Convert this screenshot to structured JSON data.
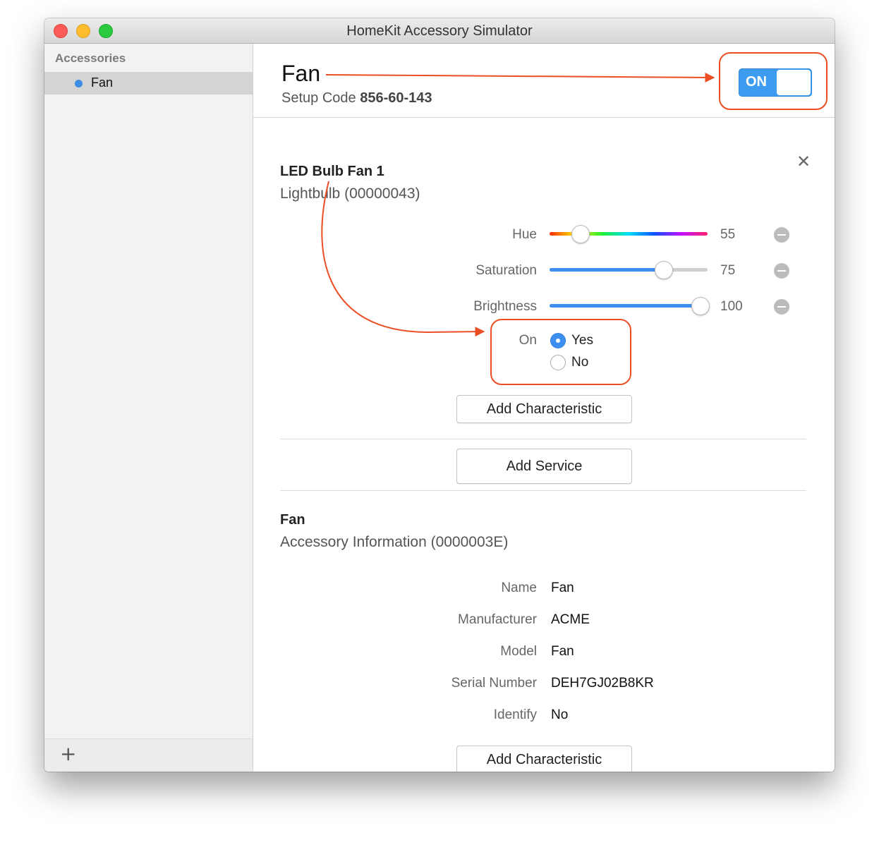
{
  "window": {
    "title": "HomeKit Accessory Simulator"
  },
  "sidebar": {
    "header": "Accessories",
    "items": [
      {
        "label": "Fan",
        "dot_color": "#3b8ce3"
      }
    ],
    "add_icon": "plus-icon",
    "add_glyph": "+"
  },
  "accessory": {
    "name": "Fan",
    "setup_code_label": "Setup Code",
    "setup_code": "856-60-143",
    "power_toggle": {
      "label": "ON",
      "state": "on"
    }
  },
  "services": [
    {
      "name": "LED Bulb Fan 1",
      "type": "Lightbulb (00000043)",
      "close_glyph": "✕",
      "characteristics": {
        "hue": {
          "label": "Hue",
          "value": "55",
          "fraction": 0.19
        },
        "saturation": {
          "label": "Saturation",
          "value": "75",
          "fraction": 0.72
        },
        "brightness": {
          "label": "Brightness",
          "value": "100",
          "fraction": 0.95
        },
        "on": {
          "label": "On",
          "options": [
            "Yes",
            "No"
          ],
          "selected": "Yes"
        }
      },
      "add_characteristic_label": "Add Characteristic"
    },
    {
      "name": "Fan",
      "type": "Accessory Information (0000003E)",
      "fields": [
        {
          "label": "Name",
          "value": "Fan"
        },
        {
          "label": "Manufacturer",
          "value": "ACME"
        },
        {
          "label": "Model",
          "value": "Fan"
        },
        {
          "label": "Serial Number",
          "value": "DEH7GJ02B8KR"
        },
        {
          "label": "Identify",
          "value": "No"
        }
      ],
      "add_characteristic_label": "Add Characteristic"
    }
  ],
  "add_service_label": "Add Service",
  "colors": {
    "accent": "#3d9cf0",
    "callout": "#ec4e23",
    "selection": "#d4d4d4"
  }
}
